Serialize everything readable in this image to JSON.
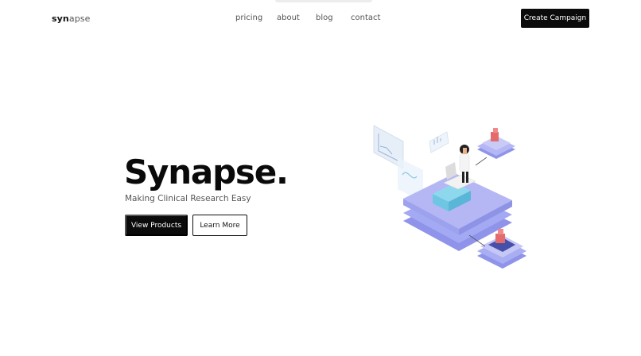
{
  "navbar": {
    "logo_bold": "syn",
    "logo_light": "apse",
    "links": [
      "pricing",
      "about",
      "blog",
      "contact"
    ],
    "cta_label": "Create Campaign"
  },
  "hero": {
    "title": "Synapse.",
    "subtitle": "Making Clinical Research Easy",
    "primary_button": "View Products",
    "secondary_button": "Learn More"
  },
  "illustration": {
    "icon": "isometric-clinical-research-illustration",
    "colors": {
      "platform_top": "#b9b8f3",
      "platform_side": "#8f94ea",
      "platform_cyan": "#8ed8ee",
      "accent_red": "#e36b6b",
      "panel": "#e4eef8"
    }
  }
}
